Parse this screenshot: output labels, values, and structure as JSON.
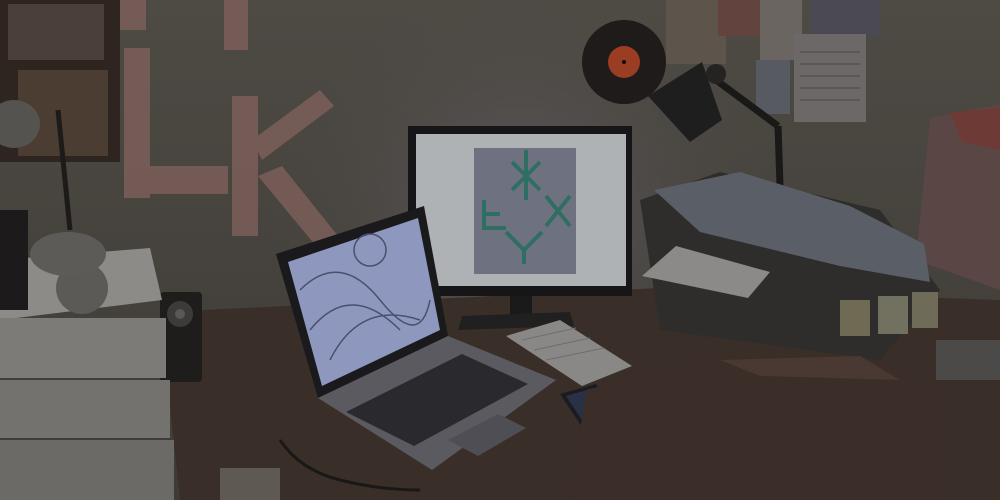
{
  "scene": {
    "colors": {
      "wall": "#4a4640",
      "wall_light": "#5a5650",
      "desk": "#3a2f28",
      "monitor_glow": "#8c94a4",
      "screen": "#aeb2b4",
      "art_panel": "#6e7280",
      "art_glyph": "#2f6f63",
      "laptop_screen": "#8e98be",
      "vinyl": "#1e1b1a",
      "vinyl_label": "#9a3d23",
      "tape": "#7c5f5a",
      "printer": "#2f2d2b",
      "chair": "#3b2d28",
      "drawers": "#b9b7b2"
    }
  }
}
